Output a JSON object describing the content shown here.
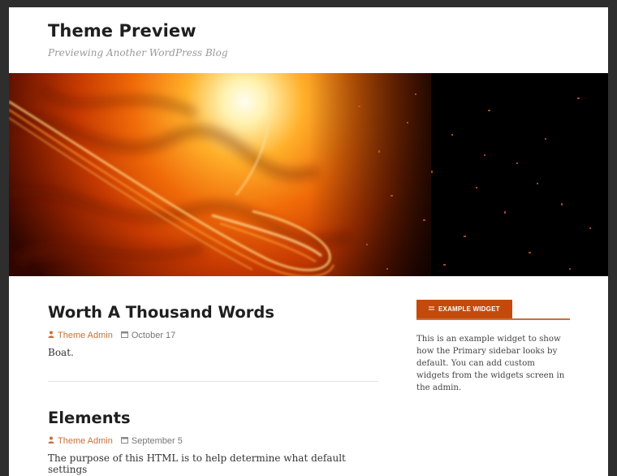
{
  "header": {
    "title": "Theme Preview",
    "description": "Previewing Another WordPress Blog"
  },
  "hero": {
    "image": "space-planet-rings-header"
  },
  "posts": [
    {
      "title": "Worth A Thousand Words",
      "author": "Theme Admin",
      "date": "October 17",
      "excerpt": "Boat."
    },
    {
      "title": "Elements",
      "author": "Theme Admin",
      "date": "September 5",
      "excerpt": "The purpose of this HTML is to help determine what default settings"
    }
  ],
  "sidebar": {
    "widget": {
      "title": "EXAMPLE WIDGET",
      "icon": "menu-lines-icon",
      "text": "This is an example widget to show how the Primary sidebar looks by default. You can add custom widgets from the widgets screen in the admin."
    }
  },
  "colors": {
    "accent": "#c44a0c",
    "link": "#c9703a",
    "frame": "#2e2e2e"
  }
}
